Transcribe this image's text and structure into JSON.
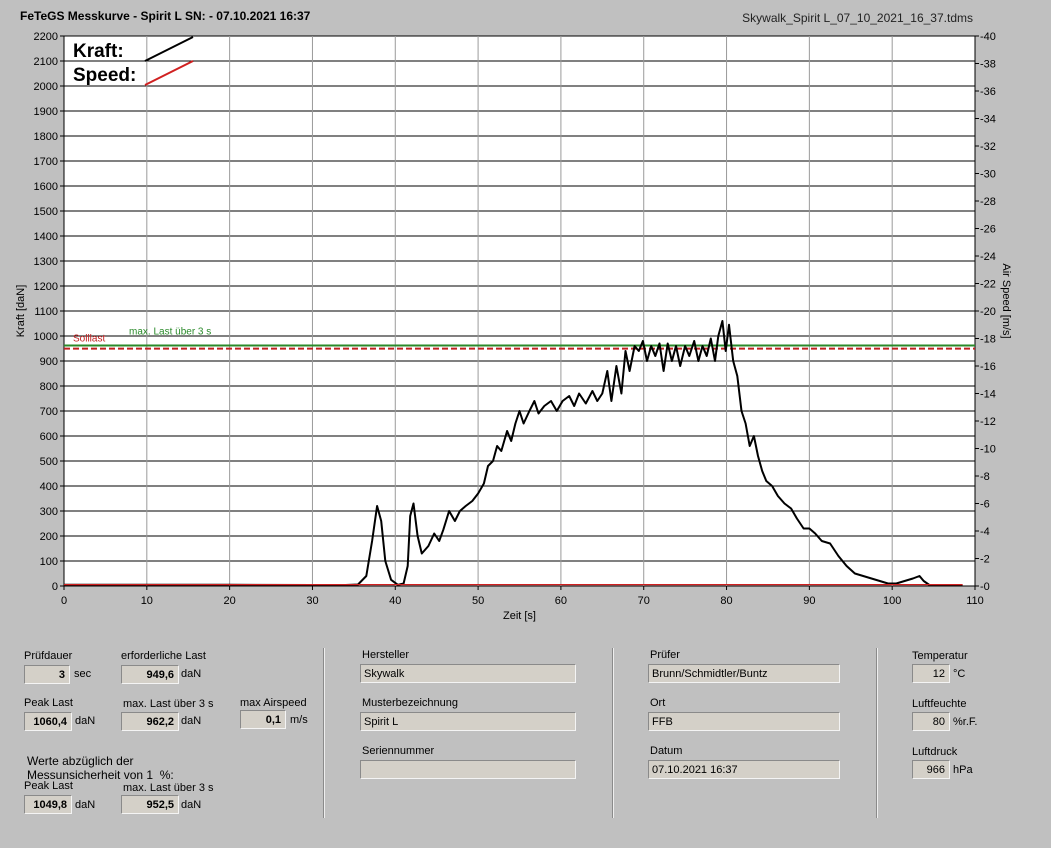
{
  "header": {
    "title": "FeTeGS Messkurve - Spirit L  SN:  - 07.10.2021 16:37",
    "file": "Skywalk_Spirit L_07_10_2021_16_37.tdms"
  },
  "chart_data": {
    "type": "line",
    "xlabel": "Zeit [s]",
    "ylabel": "Kraft [daN]",
    "y2label": "Air Speed [m/s]",
    "xlim": [
      0,
      110
    ],
    "ylim": [
      0,
      2200
    ],
    "y2lim": [
      0,
      40
    ],
    "x_ticks": [
      0,
      10,
      20,
      30,
      40,
      50,
      60,
      70,
      80,
      90,
      100,
      110
    ],
    "y_ticks": [
      0,
      100,
      200,
      300,
      400,
      500,
      600,
      700,
      800,
      900,
      1000,
      1100,
      1200,
      1300,
      1400,
      1500,
      1600,
      1700,
      1800,
      1900,
      2000,
      2100,
      2200
    ],
    "y2_ticks": [
      0,
      2,
      4,
      6,
      8,
      10,
      12,
      14,
      16,
      18,
      20,
      22,
      24,
      26,
      28,
      30,
      32,
      34,
      36,
      38,
      40
    ],
    "grid": true,
    "legend": {
      "placement": "top-left",
      "items": [
        {
          "label": "Kraft:",
          "color": "#000000"
        },
        {
          "label": "Speed:",
          "color": "#d02020"
        }
      ]
    },
    "reference_lines": [
      {
        "label": "Solllast",
        "value": 949.6,
        "color": "#c02020",
        "style": "dashed"
      },
      {
        "label": "max. Last über  3 s",
        "value": 962.2,
        "color": "#2a8a2a",
        "style": "solid"
      }
    ],
    "series": [
      {
        "name": "Kraft",
        "color": "#000000",
        "axis": "left",
        "points": [
          [
            0,
            5
          ],
          [
            10,
            5
          ],
          [
            20,
            5
          ],
          [
            30,
            4
          ],
          [
            34,
            4
          ],
          [
            35.5,
            6
          ],
          [
            36.5,
            40
          ],
          [
            37.2,
            180
          ],
          [
            37.8,
            320
          ],
          [
            38.3,
            260
          ],
          [
            38.8,
            100
          ],
          [
            39.5,
            25
          ],
          [
            40.3,
            5
          ],
          [
            41,
            10
          ],
          [
            41.5,
            80
          ],
          [
            41.8,
            280
          ],
          [
            42.2,
            330
          ],
          [
            42.7,
            200
          ],
          [
            43.2,
            130
          ],
          [
            44,
            160
          ],
          [
            44.7,
            210
          ],
          [
            45.3,
            180
          ],
          [
            45.8,
            225
          ],
          [
            46.5,
            300
          ],
          [
            47.2,
            260
          ],
          [
            47.8,
            300
          ],
          [
            48.5,
            320
          ],
          [
            49.3,
            340
          ],
          [
            50,
            370
          ],
          [
            50.7,
            410
          ],
          [
            51.2,
            480
          ],
          [
            51.8,
            500
          ],
          [
            52.3,
            560
          ],
          [
            52.8,
            540
          ],
          [
            53.5,
            620
          ],
          [
            54,
            580
          ],
          [
            54.5,
            650
          ],
          [
            55,
            700
          ],
          [
            55.5,
            650
          ],
          [
            56.2,
            700
          ],
          [
            56.8,
            740
          ],
          [
            57.3,
            690
          ],
          [
            58,
            720
          ],
          [
            58.8,
            740
          ],
          [
            59.5,
            700
          ],
          [
            60.2,
            740
          ],
          [
            61,
            760
          ],
          [
            61.6,
            720
          ],
          [
            62.2,
            770
          ],
          [
            63,
            730
          ],
          [
            63.8,
            780
          ],
          [
            64.4,
            740
          ],
          [
            65,
            770
          ],
          [
            65.6,
            860
          ],
          [
            66.1,
            740
          ],
          [
            66.7,
            880
          ],
          [
            67.3,
            770
          ],
          [
            67.8,
            940
          ],
          [
            68.3,
            860
          ],
          [
            68.9,
            960
          ],
          [
            69.4,
            940
          ],
          [
            69.9,
            980
          ],
          [
            70.4,
            900
          ],
          [
            70.9,
            960
          ],
          [
            71.4,
            920
          ],
          [
            71.9,
            970
          ],
          [
            72.4,
            860
          ],
          [
            72.9,
            970
          ],
          [
            73.4,
            900
          ],
          [
            73.9,
            960
          ],
          [
            74.4,
            880
          ],
          [
            75,
            960
          ],
          [
            75.5,
            920
          ],
          [
            76.1,
            980
          ],
          [
            76.6,
            900
          ],
          [
            77.1,
            960
          ],
          [
            77.6,
            920
          ],
          [
            78.1,
            990
          ],
          [
            78.6,
            900
          ],
          [
            79,
            1000
          ],
          [
            79.5,
            1060
          ],
          [
            79.9,
            940
          ],
          [
            80.3,
            1045
          ],
          [
            80.8,
            900
          ],
          [
            81.3,
            840
          ],
          [
            81.8,
            700
          ],
          [
            82.3,
            650
          ],
          [
            82.8,
            560
          ],
          [
            83.3,
            600
          ],
          [
            83.8,
            520
          ],
          [
            84.3,
            460
          ],
          [
            84.8,
            420
          ],
          [
            85.5,
            400
          ],
          [
            86.2,
            360
          ],
          [
            87,
            330
          ],
          [
            87.8,
            310
          ],
          [
            88.5,
            270
          ],
          [
            89.3,
            230
          ],
          [
            90,
            230
          ],
          [
            90.7,
            210
          ],
          [
            91.5,
            180
          ],
          [
            92.5,
            170
          ],
          [
            93.5,
            120
          ],
          [
            94.5,
            80
          ],
          [
            95.5,
            50
          ],
          [
            96.5,
            40
          ],
          [
            97.5,
            30
          ],
          [
            98.5,
            20
          ],
          [
            99.5,
            10
          ],
          [
            100.5,
            10
          ],
          [
            101.5,
            20
          ],
          [
            102.5,
            30
          ],
          [
            103.3,
            40
          ],
          [
            103.8,
            20
          ],
          [
            104.5,
            4
          ],
          [
            105.5,
            2
          ],
          [
            108.5,
            2
          ]
        ]
      },
      {
        "name": "Speed",
        "color": "#d02020",
        "axis": "right",
        "points": [
          [
            0,
            0.1
          ],
          [
            108.5,
            0.1
          ]
        ]
      }
    ]
  },
  "panel": {
    "pruefdauer": {
      "label": "Prüfdauer",
      "value": "3",
      "unit": "sec"
    },
    "erf_last": {
      "label": "erforderliche Last",
      "value": "949,6",
      "unit": "daN"
    },
    "peak_last": {
      "label": "Peak Last",
      "value": "1060,4",
      "unit": "daN"
    },
    "max_last": {
      "label": "max. Last über  3 s",
      "value": "962,2",
      "unit": "daN"
    },
    "max_airspeed": {
      "label": "max Airspeed",
      "value": "0,1",
      "unit": "m/s"
    },
    "note": "Werte abzüglich der\nMessunsicherheit von 1  %:",
    "peak_last2": {
      "label": "Peak Last",
      "value": "1049,8",
      "unit": "daN"
    },
    "max_last2": {
      "label": "max. Last über  3 s",
      "value": "952,5",
      "unit": "daN"
    },
    "hersteller": {
      "label": "Hersteller",
      "value": "Skywalk"
    },
    "muster": {
      "label": "Musterbezeichnung",
      "value": "Spirit L"
    },
    "serien": {
      "label": "Seriennummer",
      "value": ""
    },
    "pruefer": {
      "label": "Prüfer",
      "value": "Brunn/Schmidtler/Buntz"
    },
    "ort": {
      "label": "Ort",
      "value": "FFB"
    },
    "datum": {
      "label": "Datum",
      "value": "07.10.2021 16:37"
    },
    "temperatur": {
      "label": "Temperatur",
      "value": "12",
      "unit": "°C"
    },
    "luftfeuchte": {
      "label": "Luftfeuchte",
      "value": "80",
      "unit": "%r.F."
    },
    "luftdruck": {
      "label": "Luftdruck",
      "value": "966",
      "unit": "hPa"
    }
  }
}
